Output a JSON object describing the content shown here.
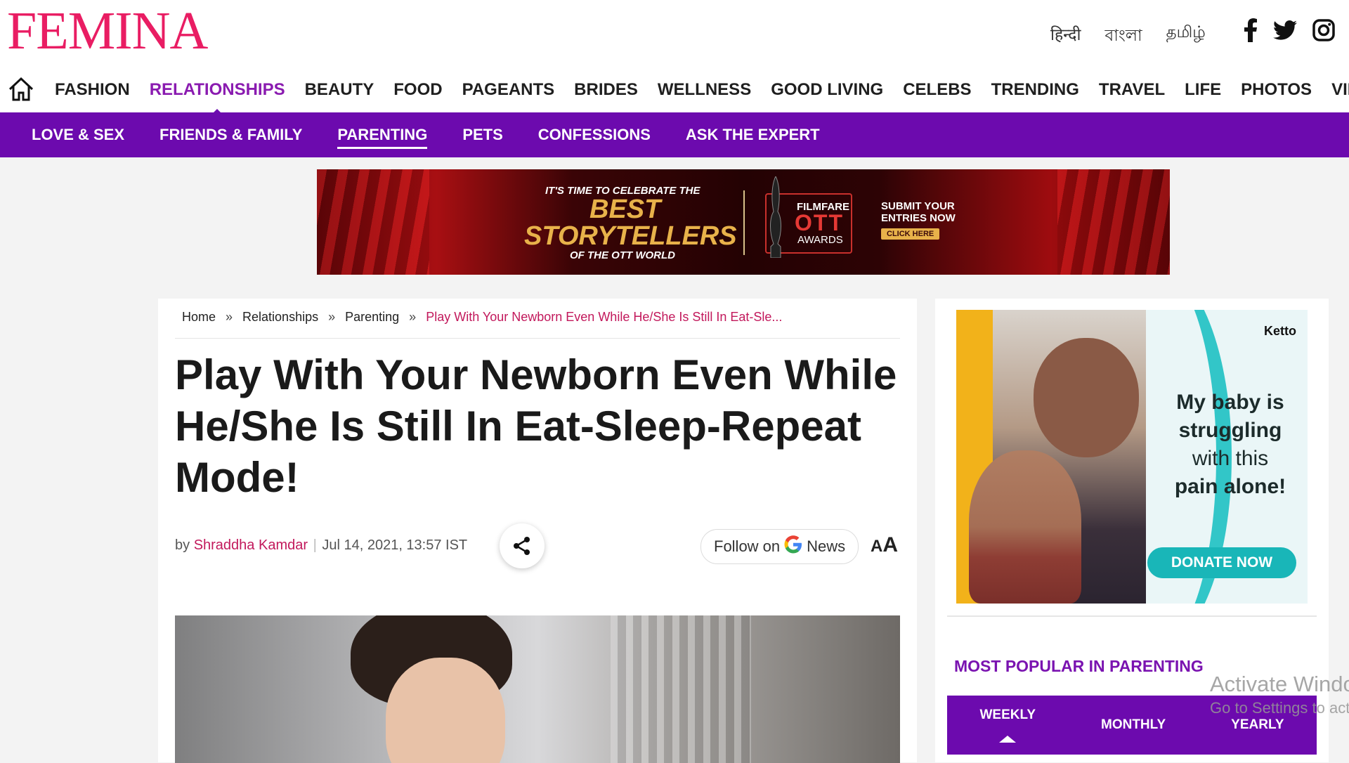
{
  "header": {
    "logo": "FEMINA",
    "languages": [
      "हिन्दी",
      "বাংলা",
      "தமிழ்"
    ],
    "socials": [
      "facebook-icon",
      "twitter-icon",
      "instagram-icon"
    ]
  },
  "main_nav": {
    "items": [
      "FASHION",
      "RELATIONSHIPS",
      "BEAUTY",
      "FOOD",
      "PAGEANTS",
      "BRIDES",
      "WELLNESS",
      "GOOD LIVING",
      "CELEBS",
      "TRENDING",
      "TRAVEL",
      "LIFE",
      "PHOTOS",
      "VIDEOS"
    ],
    "active": "RELATIONSHIPS"
  },
  "sub_nav": {
    "items": [
      "LOVE & SEX",
      "FRIENDS & FAMILY",
      "PARENTING",
      "PETS",
      "CONFESSIONS",
      "ASK THE EXPERT"
    ],
    "active": "PARENTING"
  },
  "banner": {
    "line1": "IT'S TIME TO CELEBRATE THE",
    "line2": "BEST",
    "line3": "STORYTELLERS",
    "line4": "OF THE OTT WORLD",
    "brand": "FILMFARE",
    "ott": "OTT",
    "awards": "AWARDS",
    "cta": "SUBMIT YOUR ENTRIES NOW",
    "button": "CLICK HERE"
  },
  "article": {
    "breadcrumb": [
      "Home",
      "Relationships",
      "Parenting",
      "Play With Your Newborn Even While He/She Is Still In Eat-Sle..."
    ],
    "breadcrumb_sep": "»",
    "title": "Play With Your Newborn Even While He/She Is Still In Eat-Sleep-Repeat Mode!",
    "by": "by",
    "author": "Shraddha Kamdar",
    "date": "Jul 14, 2021, 13:57 IST",
    "follow_label": "Follow on",
    "follow_g": "G",
    "follow_news": "News",
    "font_size_label": "AA"
  },
  "sidebar": {
    "ad": {
      "brand": "Ketto",
      "line1": "My baby is",
      "line2": "struggling",
      "line3": "with this",
      "line4": "pain alone!",
      "button": "DONATE NOW"
    },
    "popular_title": "MOST POPULAR IN PARENTING",
    "tabs": [
      "WEEKLY",
      "MONTHLY",
      "YEARLY"
    ],
    "active_tab": "WEEKLY"
  },
  "watermark": {
    "line1": "Activate Windows",
    "line2": "Go to Settings to activate Windows."
  },
  "colors": {
    "brand_pink": "#e91d63",
    "nav_purple": "#6c0aae",
    "active_purple": "#8a1bb0",
    "author_pink": "#c2185b",
    "teal": "#19b6b8"
  }
}
